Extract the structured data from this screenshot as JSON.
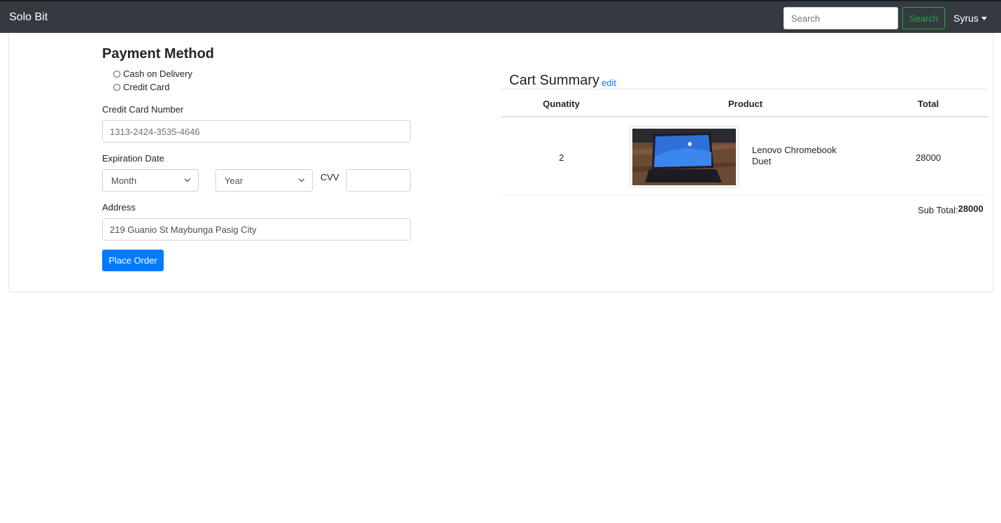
{
  "navbar": {
    "brand": "Solo Bit",
    "search_placeholder": "Search",
    "search_button": "Search",
    "user": "Syrus"
  },
  "payment": {
    "title": "Payment Method",
    "options": [
      "Cash on Delivery",
      "Credit Card"
    ],
    "card_number_label": "Credit Card Number",
    "card_number_placeholder": "1313-2424-3535-4646",
    "expiration_label": "Expiration Date",
    "month_value": "Month",
    "year_value": "Year",
    "cvv_label": "CVV",
    "address_label": "Address",
    "address_value": "219 Guanio St Maybunga Pasig City",
    "place_order": "Place Order"
  },
  "cart": {
    "title": "Cart Summary",
    "edit_link": "edit",
    "headers": [
      "Qunatity",
      "Product",
      "Total"
    ],
    "items": [
      {
        "quantity": "2",
        "product": "Lenovo Chromebook Duet",
        "total": "28000"
      }
    ],
    "subtotal_label": "Sub Total:",
    "subtotal_value": "28000"
  },
  "colors": {
    "navbar": "#343a40",
    "primary": "#007bff",
    "success": "#28a745"
  }
}
